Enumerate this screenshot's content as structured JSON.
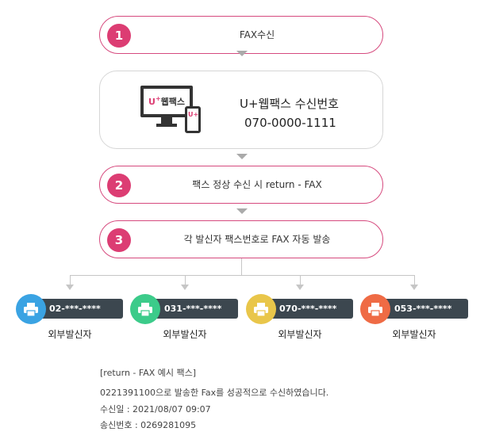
{
  "steps": [
    {
      "num": "1",
      "text": "FAX수신"
    },
    {
      "num": "2",
      "text": "팩스 정상 수신 시 return - FAX"
    },
    {
      "num": "3",
      "text": "각 발신자 팩스번호로 FAX 자동 발송"
    }
  ],
  "service": {
    "brand_prefix": "U",
    "brand_plus": "+",
    "brand_name": "웹팩스",
    "phone_badge": "U+",
    "title": "U+웹팩스 수신번호",
    "number": "070-0000-1111"
  },
  "senders": [
    {
      "fax": "02-***-****",
      "label": "외부발신자",
      "color": "#3aa3e3"
    },
    {
      "fax": "031-***-****",
      "label": "외부발신자",
      "color": "#3ccb8a"
    },
    {
      "fax": "070-***-****",
      "label": "외부발신자",
      "color": "#e9c64a"
    },
    {
      "fax": "053-***-****",
      "label": "외부발신자",
      "color": "#ef6b45"
    }
  ],
  "example": {
    "heading": "[return - FAX 예시 팩스]",
    "line1": "0221391100으로 발송한 Fax를 성공적으로 수신하였습니다.",
    "line2": "수신일 : 2021/08/07 09:07",
    "line3": "송신번호 : 0269281095"
  },
  "colors": {
    "accent": "#dc3d73",
    "bar": "#3c474f",
    "arrow": "#aaaaaa"
  }
}
